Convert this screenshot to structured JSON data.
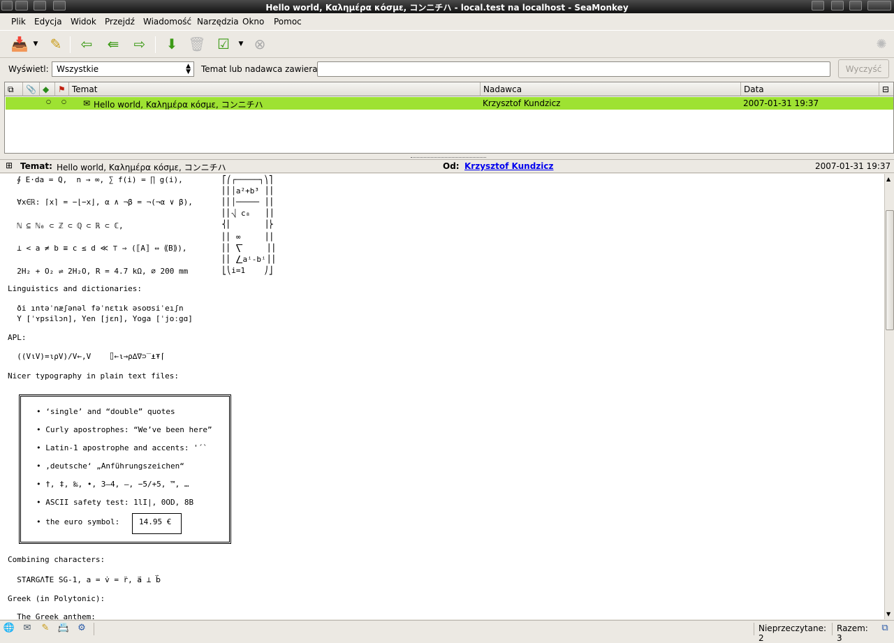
{
  "window": {
    "title": "Hello world, Καλημέρα κόσμε, コンニチハ - local.test na localhost - SeaMonkey"
  },
  "menu": [
    {
      "label": "Plik"
    },
    {
      "label": "Edycja"
    },
    {
      "label": "Widok"
    },
    {
      "label": "Przejdź"
    },
    {
      "label": "Wiadomość"
    },
    {
      "label": "Narzędzia"
    },
    {
      "label": "Okno"
    },
    {
      "label": "Pomoc"
    }
  ],
  "toolbar": {
    "icons": [
      "get-mail-icon",
      "compose-icon",
      "reply-icon",
      "reply-all-icon",
      "forward-icon",
      "next-icon",
      "delete-icon",
      "mark-icon",
      "stop-icon",
      "throbber-icon"
    ]
  },
  "filter": {
    "view_label": "Wyświetl:",
    "view_value": "Wszystkie",
    "search_label": "Temat lub nadawca zawiera:",
    "search_value": "",
    "clear_label": "Wyczyść"
  },
  "thread_columns": {
    "subject": "Temat",
    "sender": "Nadawca",
    "date": "Data"
  },
  "messages": [
    {
      "subject": "Hello world, Καλημέρα κόσμε, コンニチハ",
      "sender": "Krzysztof Kundzicz",
      "date": "2007-01-31 19:37",
      "selected": true
    }
  ],
  "message_header": {
    "subject_label": "Temat:",
    "subject": "Hello world, Καλημέρα κόσμε, コンニチハ",
    "from_label": "Od:",
    "from": "Krzysztof Kundzicz",
    "date": "2007-01-31 19:37"
  },
  "body_lines": [
    "  ∮ E⋅da = Q,  n → ∞, ∑ f(i) = ∏ g(i),",
    "  ∀x∈ℝ: ⌈x⌉ = −⌊−x⌋, α ∧ ¬β = ¬(¬α ∨ β),",
    "  ℕ ⊆ ℕ₀ ⊂ ℤ ⊂ ℚ ⊂ ℝ ⊂ ℂ,",
    "  ⊥ < a ≠ b ≡ c ≤ d ≪ ⊤ ⇒ (⟦A⟧ ⇔ ⟪B⟫),",
    "  2H₂ + O₂ ⇌ 2H₂O, R = 4.7 kΩ, ⌀ 200 mm",
    "Linguistics and dictionaries:",
    "  ði ıntəˈnæʃənəl fəˈnɛtık əsoʊsiˈeıʃn",
    "  Y [ˈʏpsilɔn], Yen [jɛn], Yoga [ˈjoːgɑ]",
    "APL:",
    "  ((V⍳V)=⍳⍴V)/V←,V    ⌷←⍳→⍴∆∇⊃‾⍎⍕⌈",
    "Nicer typography in plain text files:",
    "Combining characters:",
    "  STARGΛ̊TE SG-1, a = v̇ = r̈, a⃑ ⊥ b⃑",
    "Greek (in Polytonic):",
    "  The Greek anthem:"
  ],
  "math_block": [
    "⎡⎛┌─────┐⎞⎤",
    "⎢⎜│a²+b³ ⎟⎥",
    "⎢⎜│───── ⎟⎥",
    "⎢⎜⎷ c₈   ⎟⎥",
    "⎨⎜       ⎟⎬",
    "⎢⎜ ∞     ⎟⎥",
    "⎢⎜ ⎲     ⎟⎥",
    "⎢⎜ ⎳aⁱ-bⁱ⎟⎥",
    "⎣⎝i=1    ⎠⎦"
  ],
  "typo_box": [
    "• ‘single’ and “double” quotes",
    "• Curly apostrophes: “We’ve been here”",
    "• Latin-1 apostrophe and accents: '´`",
    "• ‚deutsche‘ „Anführungszeichen“",
    "• †, ‡, ‰, •, 3–4, —, −5/+5, ™, …",
    "• ASCII safety test: 1lI|, 0OD, 8B",
    "• the euro symbol:"
  ],
  "euro_value": "14.95 €",
  "status": {
    "unread": "Nieprzeczytane: 2",
    "total": "Razem: 3"
  },
  "colors": {
    "selected_row": "#9ee232",
    "link": "#0000ee"
  }
}
